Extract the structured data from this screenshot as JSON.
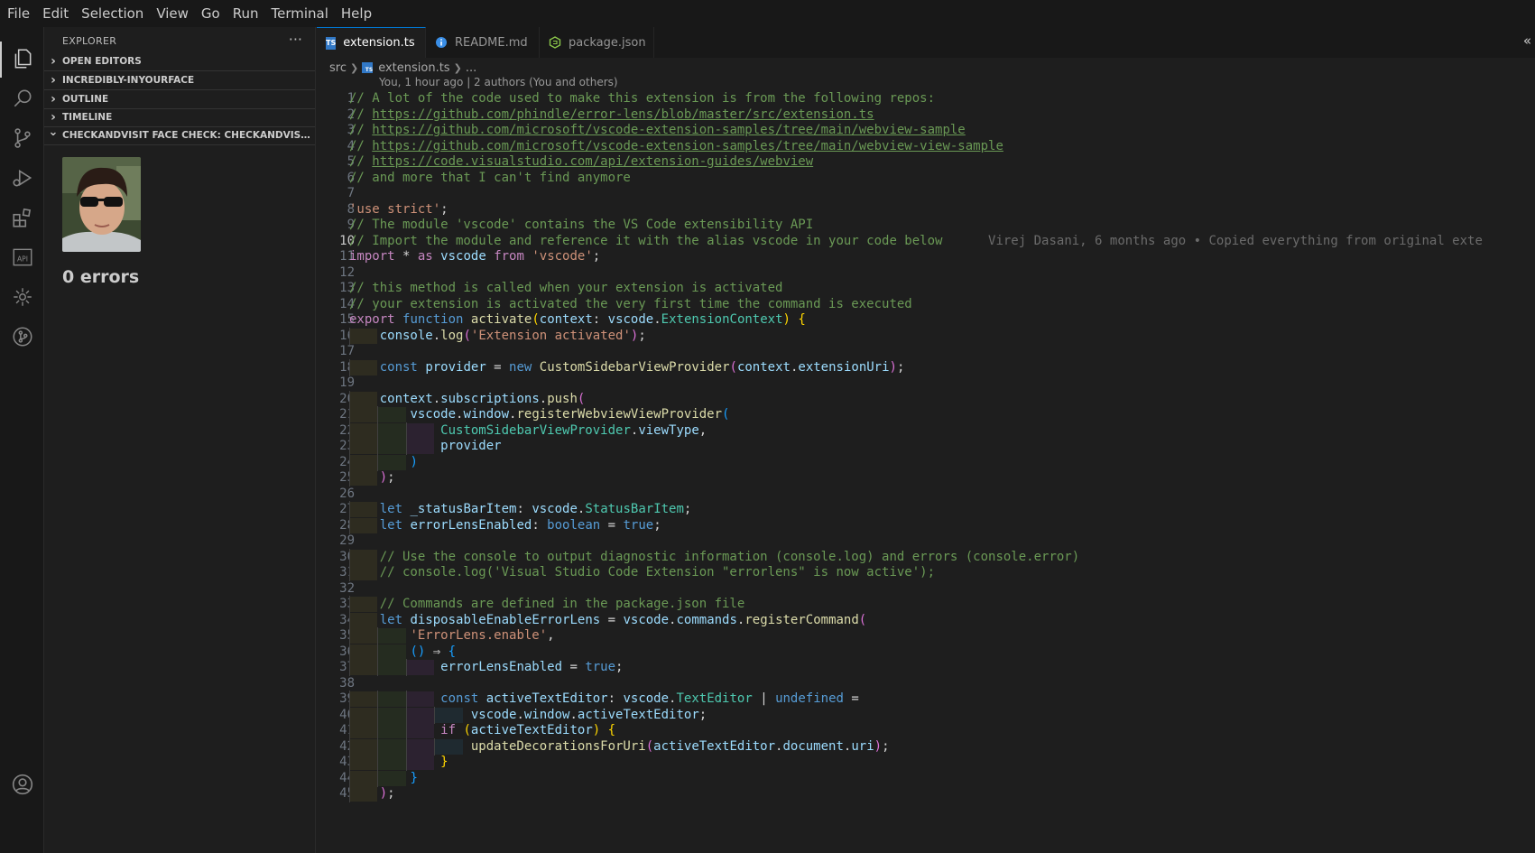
{
  "menu": [
    "File",
    "Edit",
    "Selection",
    "View",
    "Go",
    "Run",
    "Terminal",
    "Help"
  ],
  "sidebar": {
    "title": "EXPLORER",
    "more": "···",
    "sections": [
      {
        "label": "OPEN EDITORS",
        "expanded": false
      },
      {
        "label": "INCREDIBLY-INYOURFACE",
        "expanded": false
      },
      {
        "label": "OUTLINE",
        "expanded": false
      },
      {
        "label": "TIMELINE",
        "expanded": false
      },
      {
        "label": "CHECKANDVISIT FACE CHECK: CHECKANDVISIT FA...",
        "expanded": true
      }
    ],
    "errors_label": "0 errors"
  },
  "tabs": [
    {
      "label": "extension.ts",
      "icon": "typescript-icon",
      "active": true,
      "close": "×"
    },
    {
      "label": "README.md",
      "icon": "info-icon",
      "active": false
    },
    {
      "label": "package.json",
      "icon": "nodejs-icon",
      "active": false
    }
  ],
  "breadcrumb": {
    "folder": "src",
    "file": "extension.ts",
    "more": "..."
  },
  "codelens": "You, 1 hour ago | 2 authors (You and others)",
  "current_line": 10,
  "blame": "Virej Dasani, 6 months ago • Copied everything from original exte",
  "colors": {
    "comment": "#6a9955",
    "string": "#ce9178",
    "keyword": "#569cd6",
    "function": "#dcdcaa",
    "variable": "#9cdcfe",
    "type": "#4ec9b0",
    "accent": "#0078d4"
  },
  "code_lines": [
    "// A lot of the code used to make this extension is from the following repos:",
    "// https://github.com/phindle/error-lens/blob/master/src/extension.ts",
    "// https://github.com/microsoft/vscode-extension-samples/tree/main/webview-sample",
    "// https://github.com/microsoft/vscode-extension-samples/tree/main/webview-view-sample",
    "// https://code.visualstudio.com/api/extension-guides/webview",
    "// and more that I can't find anymore",
    "",
    "'use strict';",
    "// The module 'vscode' contains the VS Code extensibility API",
    "// Import the module and reference it with the alias vscode in your code below",
    "import * as vscode from 'vscode';",
    "",
    "// this method is called when your extension is activated",
    "// your extension is activated the very first time the command is executed",
    "export function activate(context: vscode.ExtensionContext) {",
    "    console.log('Extension activated');",
    "",
    "    const provider = new CustomSidebarViewProvider(context.extensionUri);",
    "",
    "    context.subscriptions.push(",
    "        vscode.window.registerWebviewViewProvider(",
    "            CustomSidebarViewProvider.viewType,",
    "            provider",
    "        )",
    "    );",
    "",
    "    let _statusBarItem: vscode.StatusBarItem;",
    "    let errorLensEnabled: boolean = true;",
    "",
    "    // Use the console to output diagnostic information (console.log) and errors (console.error)",
    "    // console.log('Visual Studio Code Extension \"errorlens\" is now active');",
    "",
    "    // Commands are defined in the package.json file",
    "    let disposableEnableErrorLens = vscode.commands.registerCommand(",
    "        'ErrorLens.enable',",
    "        () ⇒ {",
    "            errorLensEnabled = true;",
    "",
    "            const activeTextEditor: vscode.TextEditor | undefined =",
    "                vscode.window.activeTextEditor;",
    "            if (activeTextEditor) {",
    "                updateDecorationsForUri(activeTextEditor.document.uri);",
    "            }",
    "        }",
    "    );"
  ]
}
